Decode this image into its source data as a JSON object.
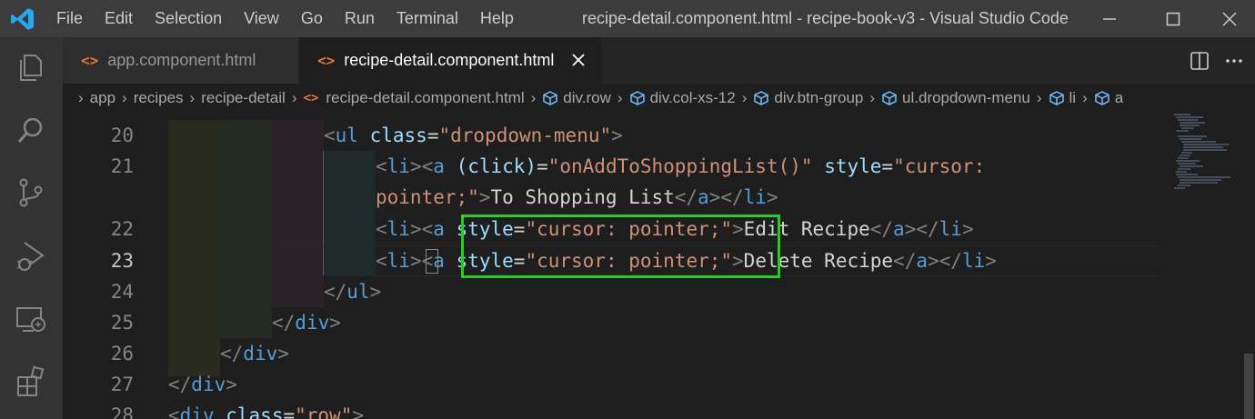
{
  "titlebar": {
    "menu": [
      "File",
      "Edit",
      "Selection",
      "View",
      "Go",
      "Run",
      "Terminal",
      "Help"
    ],
    "window_title": "recipe-detail.component.html - recipe-book-v3 - Visual Studio Code"
  },
  "tabs": [
    {
      "label": "app.component.html",
      "icon": "<>",
      "active": false
    },
    {
      "label": "recipe-detail.component.html",
      "icon": "<>",
      "active": true
    }
  ],
  "breadcrumb": {
    "folders": [
      "app",
      "recipes",
      "recipe-detail"
    ],
    "file": "recipe-detail.component.html",
    "file_icon": "<>",
    "symbols": [
      "div.row",
      "div.col-xs-12",
      "div.btn-group",
      "ul.dropdown-menu",
      "li",
      "a"
    ]
  },
  "editor": {
    "line_numbers": [
      "20",
      "21",
      "",
      "22",
      "23",
      "24",
      "25",
      "26",
      "27",
      "28"
    ],
    "current_line": "23",
    "lines": [
      {
        "t1": "<",
        "tag": "ul",
        "sp": " ",
        "a1": "class",
        "eq": "=",
        "s1": "\"dropdown-menu\"",
        "t2": ">"
      },
      {
        "t1": "<",
        "tag": "li",
        "t2": "><",
        "tag2": "a",
        "sp": " ",
        "a1": "(click)",
        "eq": "=",
        "s1": "\"onAddToShoppingList()\"",
        "sp2": " ",
        "a2": "style",
        "eq2": "=",
        "s2": "\"cursor:"
      },
      {
        "s3": "pointer;\"",
        "t3": ">",
        "text": "To Shopping List",
        "t4": "</",
        "tag3": "a",
        "t5": "></",
        "tag4": "li",
        "t6": ">"
      },
      {
        "t1": "<",
        "tag": "li",
        "t2": "><",
        "tag2": "a",
        "sp": " ",
        "a1": "style",
        "eq": "=",
        "s1": "\"cursor: pointer;\"",
        "t3": ">",
        "text": "Edit Recipe",
        "t4": "</",
        "tag3": "a",
        "t5": "></",
        "tag4": "li",
        "t6": ">"
      },
      {
        "t1": "<",
        "tag": "li",
        "t2": "><",
        "tag2": "a",
        "sp": " ",
        "a1": "style",
        "eq": "=",
        "s1": "\"cursor: pointer;\"",
        "t3": ">",
        "text": "Delete Recipe",
        "t4": "</",
        "tag3": "a",
        "t5": "></",
        "tag4": "li",
        "t6": ">"
      },
      {
        "t1": "</",
        "tag": "ul",
        "t2": ">"
      },
      {
        "t1": "</",
        "tag": "div",
        "t2": ">"
      },
      {
        "t1": "</",
        "tag": "div",
        "t2": ">"
      },
      {
        "t1": "</",
        "tag": "div",
        "t2": ">"
      },
      {
        "t1": "<",
        "tag": "div",
        "sp": " ",
        "a1": "class",
        "eq": "=",
        "s1": "\"row\"",
        "t2": ">"
      }
    ]
  },
  "colors": {
    "tag": "#569cd6",
    "attribute": "#9cdcfe",
    "string": "#ce9178",
    "punctuation": "#808080",
    "highlight_box": "#22d022"
  }
}
